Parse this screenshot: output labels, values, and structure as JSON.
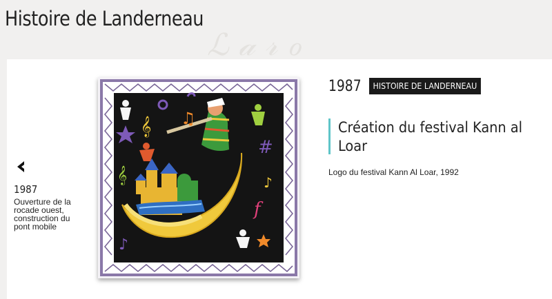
{
  "page": {
    "title": "Histoire de Landerneau"
  },
  "navigation": {
    "previous": {
      "year": "1987",
      "description": "Ouverture de la rocade ouest, construction du pont mobile"
    }
  },
  "event": {
    "year": "1987",
    "category": "HISTOIRE DE LANDERNEAU",
    "title": "Création du festival Kann al Loar",
    "caption": "Logo du festival Kann Al Loar, 1992"
  },
  "colors": {
    "accent": "#5fc5c8",
    "badge_bg": "#1a1a1a"
  },
  "icons": {
    "previous": "chevron-left-icon"
  }
}
